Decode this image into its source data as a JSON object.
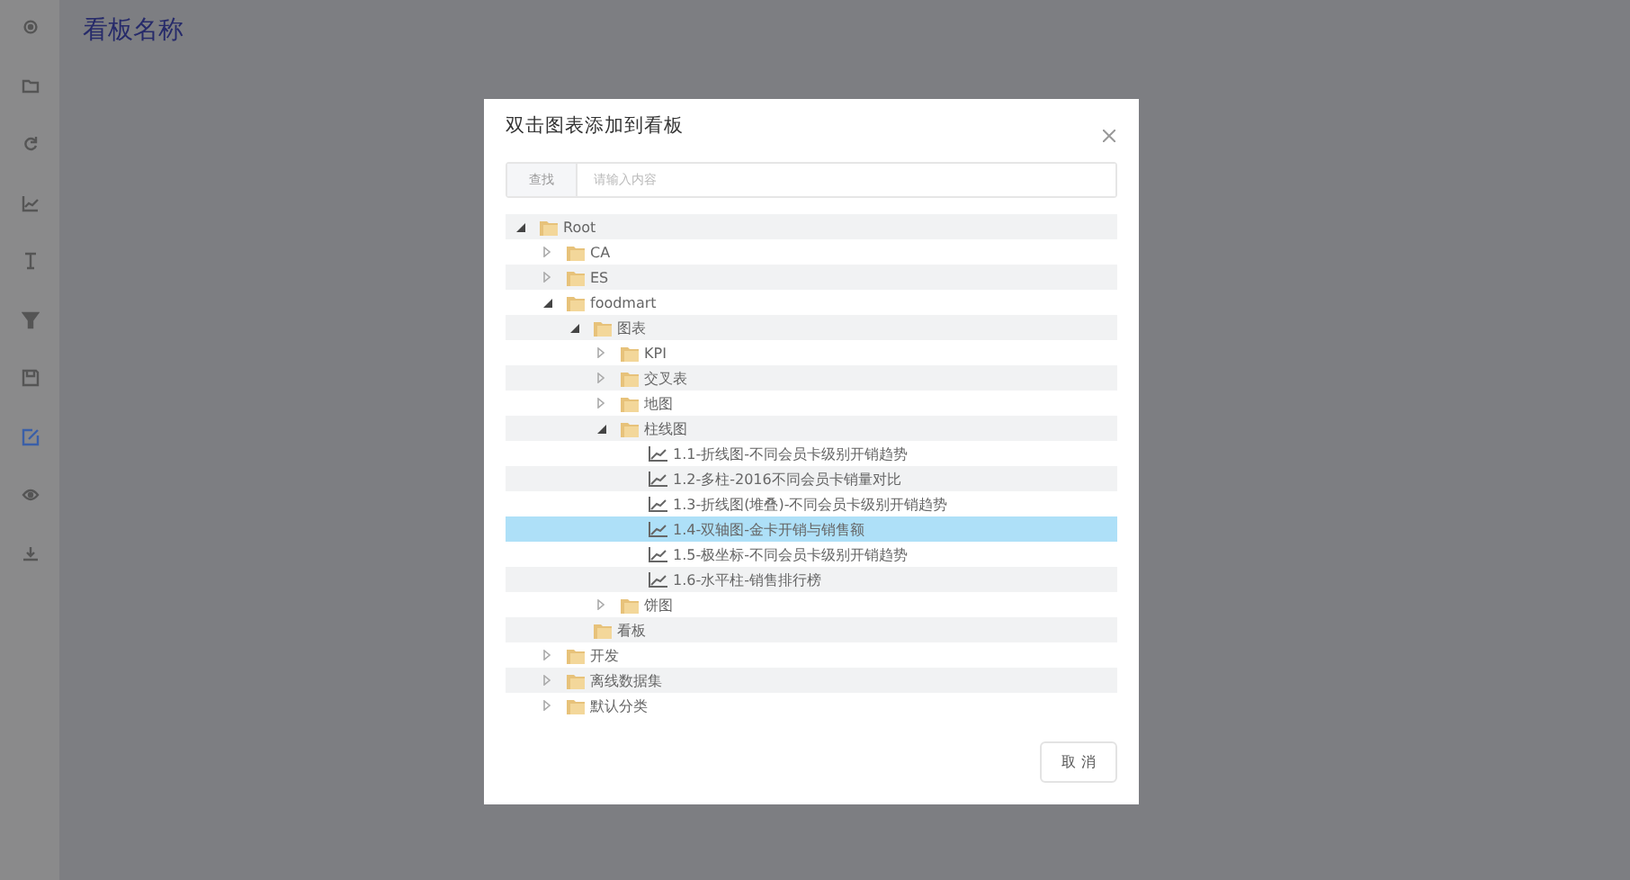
{
  "sidebar": {
    "items": [
      {
        "selected": false
      },
      {
        "selected": false
      },
      {
        "selected": false
      },
      {
        "selected": false
      },
      {
        "selected": false
      },
      {
        "selected": false
      },
      {
        "selected": false
      },
      {
        "selected": true
      },
      {
        "selected": false
      },
      {
        "selected": false
      }
    ]
  },
  "page": {
    "title": "看板名称"
  },
  "dialog": {
    "title": "双击图表添加到看板",
    "search": {
      "addon": "查找",
      "placeholder": "请输入内容"
    },
    "tree": [
      {
        "kind": "folder",
        "label": "Root",
        "expanded": true,
        "selected": false,
        "children": [
          {
            "kind": "folder",
            "label": "CA",
            "expanded": false,
            "selected": false
          },
          {
            "kind": "folder",
            "label": "ES",
            "expanded": false,
            "selected": false
          },
          {
            "kind": "folder",
            "label": "foodmart",
            "expanded": true,
            "selected": false,
            "children": [
              {
                "kind": "folder",
                "label": "图表",
                "expanded": true,
                "selected": false,
                "children": [
                  {
                    "kind": "folder",
                    "label": "KPI",
                    "expanded": false,
                    "selected": false
                  },
                  {
                    "kind": "folder",
                    "label": "交叉表",
                    "expanded": false,
                    "selected": false
                  },
                  {
                    "kind": "folder",
                    "label": "地图",
                    "expanded": false,
                    "selected": false
                  },
                  {
                    "kind": "folder",
                    "label": "柱线图",
                    "expanded": true,
                    "selected": false,
                    "children": [
                      {
                        "kind": "chart",
                        "label": "1.1-折线图-不同会员卡级别开销趋势",
                        "selected": false
                      },
                      {
                        "kind": "chart",
                        "label": "1.2-多柱-2016不同会员卡销量对比",
                        "selected": false
                      },
                      {
                        "kind": "chart",
                        "label": "1.3-折线图(堆叠)-不同会员卡级别开销趋势",
                        "selected": false
                      },
                      {
                        "kind": "chart",
                        "label": "1.4-双轴图-金卡开销与销售额",
                        "selected": true
                      },
                      {
                        "kind": "chart",
                        "label": "1.5-极坐标-不同会员卡级别开销趋势",
                        "selected": false
                      },
                      {
                        "kind": "chart",
                        "label": "1.6-水平柱-销售排行榜",
                        "selected": false
                      }
                    ]
                  },
                  {
                    "kind": "folder",
                    "label": "饼图",
                    "expanded": false,
                    "selected": false
                  }
                ]
              },
              {
                "kind": "empty-folder",
                "label": "看板",
                "selected": false
              }
            ]
          },
          {
            "kind": "folder",
            "label": "开发",
            "expanded": false,
            "selected": false
          },
          {
            "kind": "folder",
            "label": "离线数据集",
            "expanded": false,
            "selected": false
          },
          {
            "kind": "folder",
            "label": "默认分类",
            "expanded": false,
            "selected": false
          }
        ]
      }
    ],
    "buttons": [
      {
        "label": "取 消"
      }
    ]
  }
}
